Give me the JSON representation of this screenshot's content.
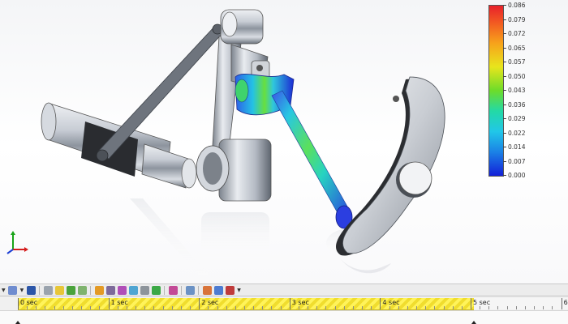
{
  "window": {
    "title": ""
  },
  "legend": {
    "labels": [
      "0.086",
      "0.079",
      "0.072",
      "0.065",
      "0.057",
      "0.050",
      "0.043",
      "0.036",
      "0.029",
      "0.022",
      "0.014",
      "0.007",
      "0.000"
    ],
    "colors": {
      "max": "#e8212b",
      "mid": "#6cdc2a",
      "min": "#1320d8"
    }
  },
  "triad": {
    "axes": [
      "x",
      "y",
      "z"
    ]
  },
  "toolbar": {
    "icons": [
      "filter-dropdown-icon",
      "rotate-view-icon",
      "save-icon",
      "zoom-icon",
      "display-style-icon",
      "add-component-icon",
      "animation-wizard-icon",
      "timeline-icon",
      "edit-sketch-icon",
      "properties-icon",
      "motor-icon",
      "spring-icon",
      "contact-icon",
      "calculate-icon",
      "results-icon",
      "plot-icon",
      "table-icon",
      "export-icon"
    ]
  },
  "timeline": {
    "labels": [
      "0 sec",
      "1 sec",
      "2 sec",
      "3 sec",
      "4 sec",
      "5 sec",
      "6"
    ]
  }
}
